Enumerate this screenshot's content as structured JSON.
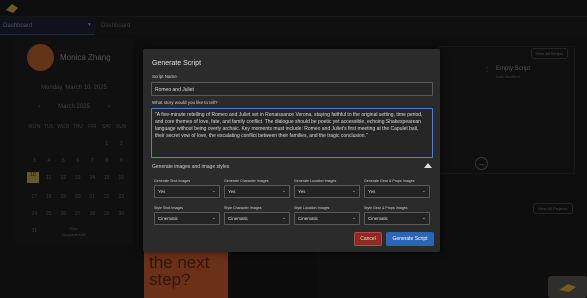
{
  "nav": {
    "workspace": "Dashboard",
    "breadcrumb": "Dashboard"
  },
  "dashboard": {
    "user_name": "Monica Zhang",
    "date": "Monday, March 10, 2025",
    "month": "March 2025",
    "weekdays": [
      "MON",
      "TUE",
      "WED",
      "THU",
      "FRI",
      "SAT",
      "SUN"
    ],
    "days": [
      "",
      "",
      "",
      "",
      "",
      "1",
      "2",
      "3",
      "4",
      "5",
      "6",
      "7",
      "8",
      "9",
      "10",
      "11",
      "12",
      "13",
      "14",
      "15",
      "16",
      "17",
      "18",
      "19",
      "20",
      "21",
      "22",
      "23",
      "24",
      "25",
      "26",
      "27",
      "28",
      "29",
      "30",
      "31"
    ],
    "today": "10",
    "plan_line1": "Plan",
    "plan_line2": "Upgrade/Left",
    "view_all_scripts": "View All Scripts",
    "empty_script_title": "Empty Script",
    "empty_script_sub": "Last Modified",
    "view_all_projects": "View All Projects",
    "promo_line1": "the next",
    "promo_line2": "step?"
  },
  "modal": {
    "title": "Generate Script",
    "script_name_label": "Script Name",
    "script_name_value": "Romeo and Juliet",
    "story_label": "What story would you like to tell?",
    "story_value": "\"A five-minute retelling of Romeo and Juliet set in Renaissance Verona, staying faithful to the original setting, time period, and core themes of love, fate, and family conflict. The dialogue should be poetic yet accessible, echoing Shakespearean language without being overly archaic. Key moments must include: Romeo and Juliet's first meeting at the Capulet ball, their secret vow of love, the escalating conflict between their families, and the tragic conclusion.\"",
    "images_section": "Generate images and image styles",
    "row1": [
      {
        "label": "Generate Shot Images",
        "value": "Yes"
      },
      {
        "label": "Generate Character Images",
        "value": "Yes"
      },
      {
        "label": "Generate Location Images",
        "value": "Yes"
      },
      {
        "label": "Generate Gear & Props Images",
        "value": "Yes"
      }
    ],
    "row2": [
      {
        "label": "Style Shot Images",
        "value": "Cinematic"
      },
      {
        "label": "Style Character Images",
        "value": "Cinematic"
      },
      {
        "label": "Style Location Images",
        "value": "Cinematic"
      },
      {
        "label": "Style Gear & Props Images",
        "value": "Cinematic"
      }
    ],
    "cancel_label": "Cancel",
    "generate_label": "Generate Script"
  },
  "colors": {
    "accent_blue": "#2c64b6",
    "cancel_red": "#8f2a22",
    "focus_blue": "#4f7fd1"
  }
}
